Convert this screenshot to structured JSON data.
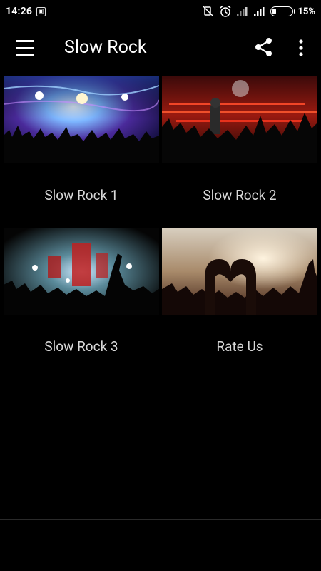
{
  "status_bar": {
    "time": "14:26",
    "battery_percent": "15%",
    "icons": [
      "notification-icon",
      "mute-icon",
      "alarm-icon",
      "signal-icon",
      "signal-icon",
      "battery-icon"
    ]
  },
  "toolbar": {
    "title": "Slow Rock",
    "menu_icon": "menu-icon",
    "share_icon": "share-icon",
    "more_icon": "more-vert-icon"
  },
  "grid": {
    "items": [
      {
        "label": "Slow Rock 1",
        "image": "concert-stage-blue-lights"
      },
      {
        "label": "Slow Rock 2",
        "image": "concert-red-lights-crowd"
      },
      {
        "label": "Slow Rock 3",
        "image": "concert-stage-smoke"
      },
      {
        "label": "Rate Us",
        "image": "concert-heart-hands"
      }
    ]
  },
  "colors": {
    "background": "#000000",
    "text": "#ffffff",
    "label": "#d8d8d8"
  }
}
